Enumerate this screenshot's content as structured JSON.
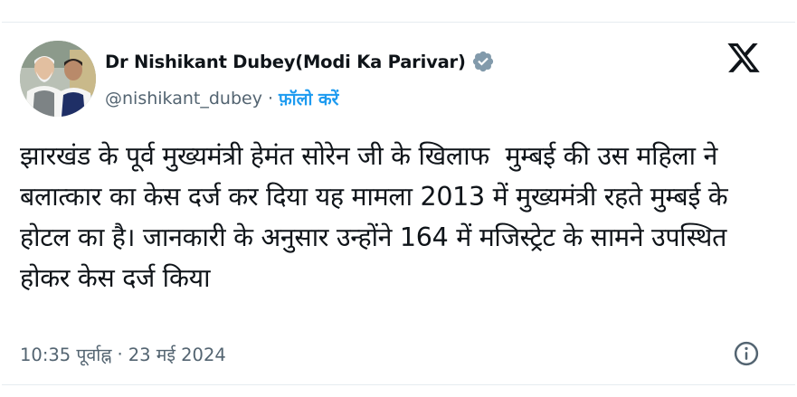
{
  "tweet": {
    "author_name": "Dr Nishikant Dubey(Modi Ka Parivar)",
    "handle": "@nishikant_dubey",
    "separator": "·",
    "follow_label": "फ़ॉलो करें",
    "verified": true,
    "text": "झारखंड के पूर्व मुख्यमंत्री हेमंत सोरेन जी के खिलाफ  मुम्बई की उस महिला ने बलात्कार का केस दर्ज कर दिया यह मामला 2013 में मुख्यमंत्री रहते मुम्बई के होटल का है। जानकारी के अनुसार उन्होंने 164 में मजिस्ट्रेट के सामने उपस्थित होकर केस दर्ज किया",
    "time": "10:35 पूर्वाह्न",
    "date_separator": "·",
    "date": "23 मई 2024"
  },
  "icons": {
    "avatar": "profile-photo",
    "verified": "verified-badge-icon",
    "logo": "x-logo-icon",
    "info": "info-icon"
  },
  "colors": {
    "accent": "#1d9bf0",
    "verified": "#829aab",
    "text": "#0f1419",
    "muted": "#536471"
  }
}
